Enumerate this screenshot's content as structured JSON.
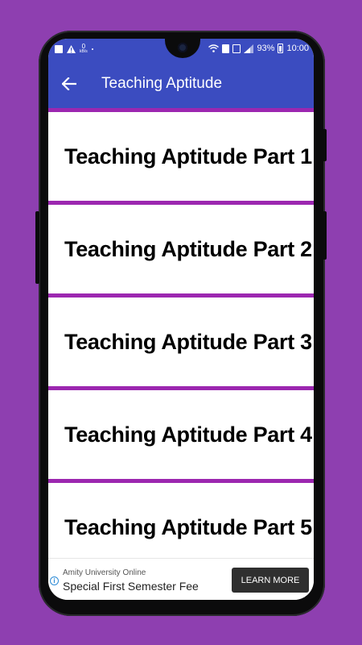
{
  "statusbar": {
    "speed_value": "0",
    "speed_unit": "kB/s",
    "battery_percent": "93%",
    "time": "10:00"
  },
  "appbar": {
    "title": "Teaching Aptitude"
  },
  "list": {
    "items": [
      {
        "label": "Teaching Aptitude Part 1"
      },
      {
        "label": "Teaching Aptitude Part 2"
      },
      {
        "label": "Teaching Aptitude Part 3"
      },
      {
        "label": "Teaching Aptitude Part 4"
      },
      {
        "label": "Teaching Aptitude Part 5"
      }
    ]
  },
  "ad": {
    "advertiser": "Amity University Online",
    "headline": "Special First Semester Fee",
    "cta": "LEARN MORE",
    "info_glyph": "i"
  },
  "colors": {
    "background": "#8e3fb0",
    "appbar": "#3b4cc0",
    "divider": "#9c27b0"
  }
}
